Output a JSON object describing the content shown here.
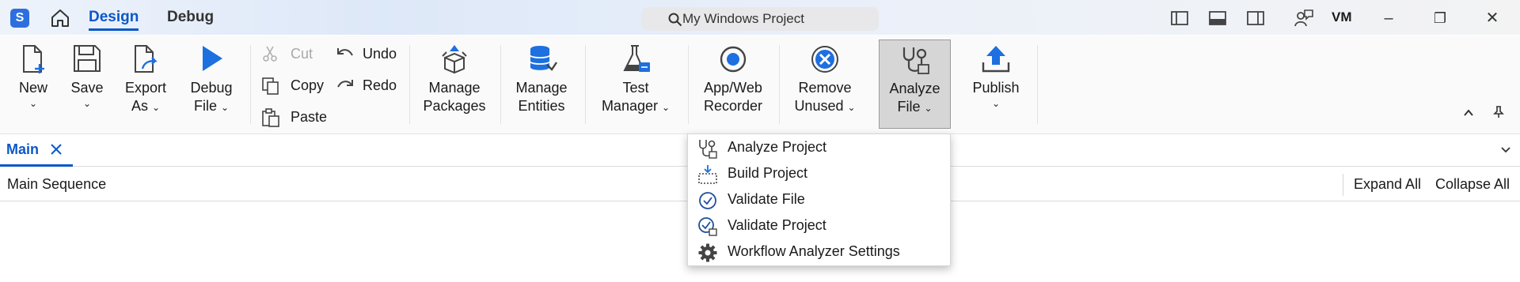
{
  "titlebar": {
    "logo_glyph": "S",
    "tabs": [
      {
        "label": "Design"
      },
      {
        "label": "Debug"
      }
    ],
    "search": {
      "label": "My Windows Project"
    },
    "user_initials": "VM",
    "window_controls": {
      "minimize": "–",
      "maximize": "❐",
      "close": "✕"
    }
  },
  "ribbon": {
    "new": {
      "label": "New"
    },
    "save": {
      "label": "Save"
    },
    "export": {
      "label_line1": "Export",
      "label_line2": "As"
    },
    "debug_file": {
      "label_line1": "Debug",
      "label_line2": "File"
    },
    "cut": {
      "label": "Cut"
    },
    "copy": {
      "label": "Copy"
    },
    "paste": {
      "label": "Paste"
    },
    "undo": {
      "label": "Undo"
    },
    "redo": {
      "label": "Redo"
    },
    "manage_packages": {
      "label_line1": "Manage",
      "label_line2": "Packages"
    },
    "manage_entities": {
      "label_line1": "Manage",
      "label_line2": "Entities"
    },
    "test_manager": {
      "label_line1": "Test",
      "label_line2": "Manager"
    },
    "recorder": {
      "label_line1": "App/Web",
      "label_line2": "Recorder"
    },
    "remove_unused": {
      "label_line1": "Remove",
      "label_line2": "Unused"
    },
    "analyze_file": {
      "label_line1": "Analyze",
      "label_line2": "File"
    },
    "publish": {
      "label": "Publish"
    },
    "chevron": "⌄"
  },
  "doc_tabs": [
    {
      "label": "Main"
    }
  ],
  "sequence": {
    "title": "Main Sequence",
    "expand_all": "Expand All",
    "collapse_all": "Collapse All"
  },
  "analyze_menu": {
    "items": [
      {
        "label": "Analyze Project",
        "icon": "stethoscope-icon"
      },
      {
        "label": "Build Project",
        "icon": "build-icon"
      },
      {
        "label": "Validate File",
        "icon": "check-circle-icon"
      },
      {
        "label": "Validate Project",
        "icon": "validate-project-icon"
      },
      {
        "label": "Workflow Analyzer Settings",
        "icon": "gear-icon"
      }
    ]
  },
  "colors": {
    "accent": "#0b57c8",
    "ribbon_bg": "#fafafa",
    "active_btn": "#d6d6d6"
  }
}
